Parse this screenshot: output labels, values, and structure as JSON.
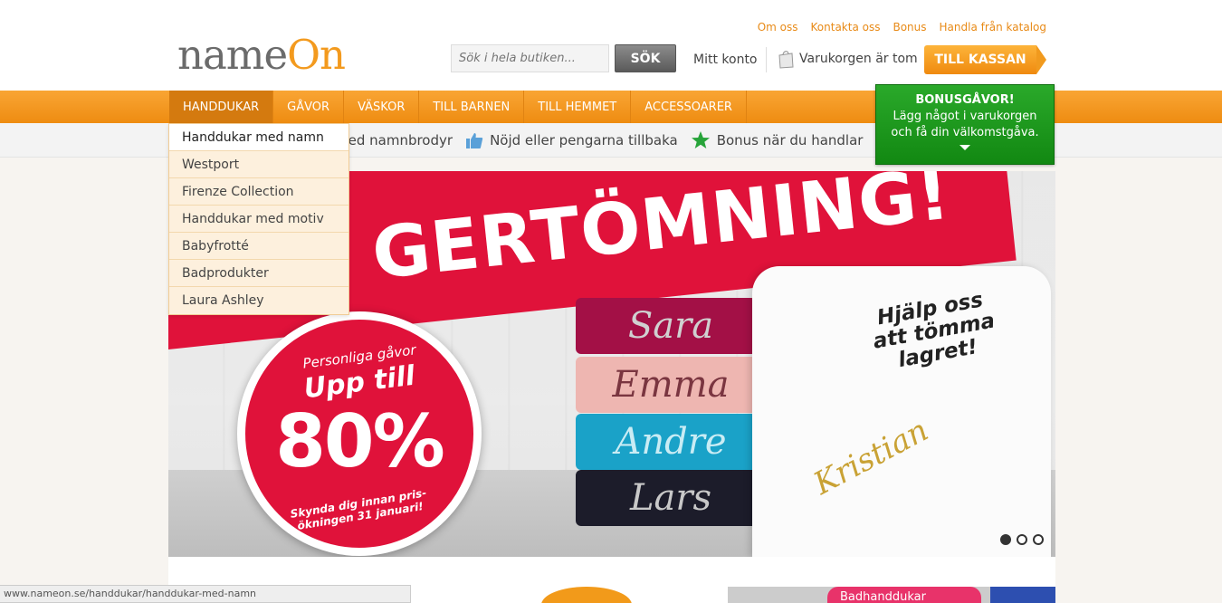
{
  "logo": {
    "part1": "name",
    "part2": "On"
  },
  "toplinks": [
    "Om oss",
    "Kontakta oss",
    "Bonus",
    "Handla från katalog"
  ],
  "search": {
    "placeholder": "Sök i hela butiken...",
    "button": "SÖK"
  },
  "account": {
    "label": "Mitt konto"
  },
  "cart": {
    "label": "Varukorgen är tom",
    "icon": "shopping-bag-icon"
  },
  "checkout": {
    "label": "TILL KASSAN"
  },
  "nav": {
    "items": [
      "HANDDUKAR",
      "GÅVOR",
      "VÄSKOR",
      "TILL BARNEN",
      "TILL HEMMET",
      "ACCESSOARER"
    ],
    "active": "HANDDUKAR"
  },
  "usp": {
    "items": [
      "Handdukar med namnbrodyr",
      "Nöjd eller pengarna tillbaka",
      "Bonus när du handlar"
    ],
    "visible_first": "med namnbrodyr"
  },
  "bonus": {
    "title": "BONUSGÅVOR!",
    "line1": "Lägg något i varukorgen",
    "line2": "och få din välkomstgåva."
  },
  "dropdown": {
    "items": [
      "Handdukar med namn",
      "Westport",
      "Firenze Collection",
      "Handdukar med motiv",
      "Babyfrotté",
      "Badprodukter",
      "Laura Ashley"
    ],
    "hovered": "Handdukar med namn"
  },
  "banner": {
    "headline": "GERTÖMNING!",
    "names": [
      "Sara",
      "Emma",
      "Andre",
      "Lars",
      "Kristian"
    ],
    "help": [
      "Hjälp oss",
      "att tömma",
      "lagret!"
    ],
    "circle": {
      "small": "Personliga gåvor",
      "big": "Upp till",
      "percent": "80%",
      "footer1": "Skynda dig innan pris-",
      "footer2": "ökningen 31 januari!"
    },
    "slides": 3,
    "active_slide": 1
  },
  "tile": {
    "pink": "Badhanddukar"
  },
  "statusbar": "www.nameon.se/handdukar/handdukar-med-namn",
  "colors": {
    "orange": "#f39a1e",
    "green": "#1a9a1a",
    "red": "#e0123a"
  }
}
